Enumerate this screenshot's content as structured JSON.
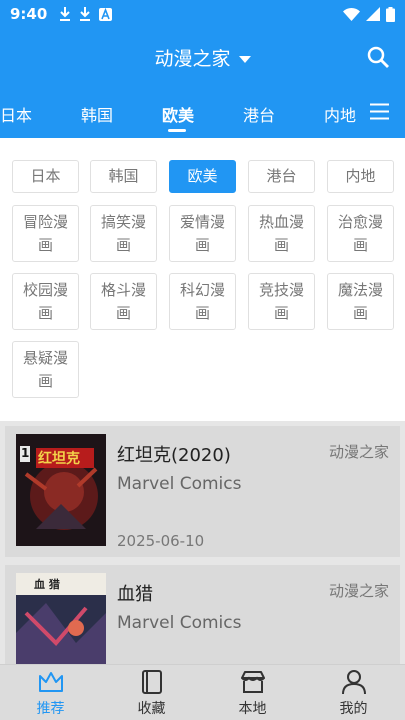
{
  "status_bar": {
    "time": "9:40"
  },
  "header": {
    "title": "动漫之家",
    "search_icon": "search-icon",
    "dropdown_icon": "caret-down-icon"
  },
  "tabs": [
    {
      "label": "日本",
      "active": false
    },
    {
      "label": "韩国",
      "active": false
    },
    {
      "label": "欧美",
      "active": true
    },
    {
      "label": "港台",
      "active": false
    },
    {
      "label": "内地",
      "active": false
    }
  ],
  "filter": {
    "regions": [
      {
        "label": "日本",
        "active": false
      },
      {
        "label": "韩国",
        "active": false
      },
      {
        "label": "欧美",
        "active": true
      },
      {
        "label": "港台",
        "active": false
      },
      {
        "label": "内地",
        "active": false
      }
    ],
    "genres": [
      "冒险漫画",
      "搞笑漫画",
      "爱情漫画",
      "热血漫画",
      "治愈漫画",
      "校园漫画",
      "格斗漫画",
      "科幻漫画",
      "竞技漫画",
      "魔法漫画",
      "悬疑漫画"
    ]
  },
  "comics": [
    {
      "title": "红坦克(2020)",
      "source": "动漫之家",
      "publisher": "Marvel Comics",
      "date": "2025-06-10",
      "cover_issue": "1",
      "cover_text": "红坦克"
    },
    {
      "title": "血猎",
      "source": "动漫之家",
      "publisher": "Marvel Comics",
      "date": "",
      "cover_issue": "",
      "cover_text": "血 猎"
    }
  ],
  "bottom_nav": [
    {
      "label": "推荐",
      "icon": "crown-icon",
      "active": true
    },
    {
      "label": "收藏",
      "icon": "book-icon",
      "active": false
    },
    {
      "label": "本地",
      "icon": "store-icon",
      "active": false
    },
    {
      "label": "我的",
      "icon": "person-icon",
      "active": false
    }
  ],
  "colors": {
    "primary": "#2196f3",
    "background": "#e6e6e6",
    "card": "#dadada"
  }
}
